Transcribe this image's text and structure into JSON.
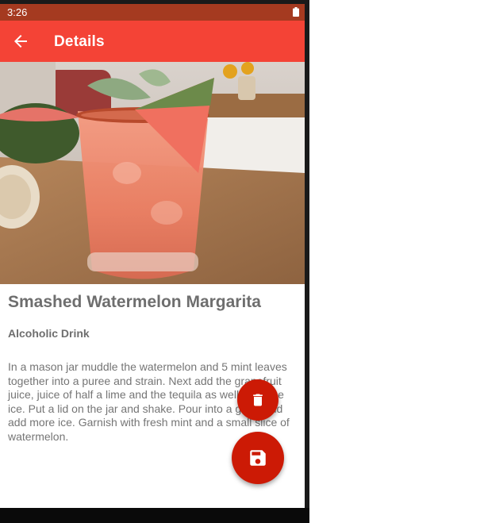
{
  "status_bar": {
    "time": "3:26",
    "battery_icon": "battery-icon"
  },
  "app_bar": {
    "title": "Details",
    "back_icon": "arrow-back-icon"
  },
  "drink": {
    "name": "Smashed Watermelon Margarita",
    "category": "Alcoholic Drink",
    "instructions": "In a mason jar muddle the watermelon and 5 mint leaves together into a puree and strain. Next add the grapefruit juice, juice of half a lime and the tequila as well as some ice. Put a lid on the jar and shake. Pour into a glass and add more ice. Garnish with fresh mint and a small slice of watermelon."
  },
  "fabs": {
    "delete_icon": "trash-icon",
    "save_icon": "save-icon"
  },
  "colors": {
    "app_bar": "#f44336",
    "status_bar": "#a53a20",
    "fab": "#cc1a05",
    "text": "#6e6e6e"
  }
}
